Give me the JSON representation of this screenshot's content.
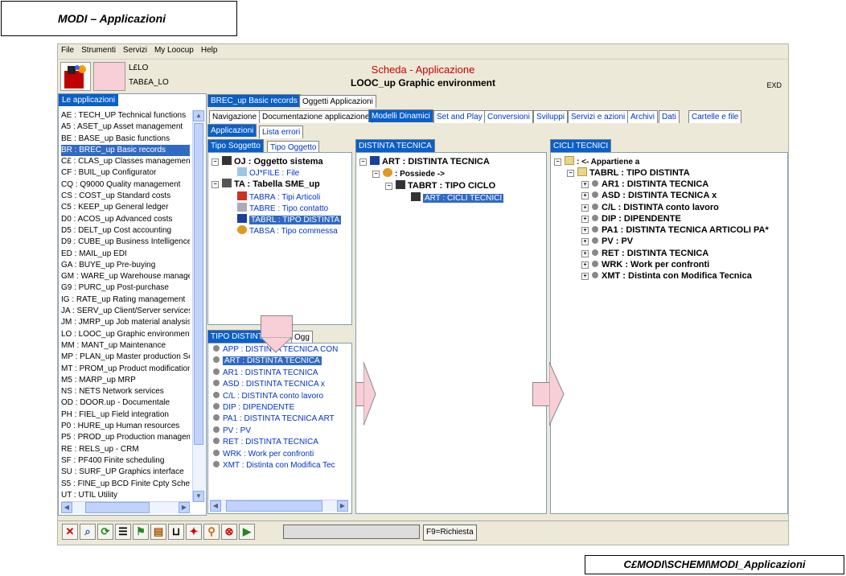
{
  "doc": {
    "title": "MODI – Applicazioni",
    "footer": "C£MODI\\SCHEMI\\MODI_Applicazioni"
  },
  "menu": [
    "File",
    "Strumenti",
    "Servizi",
    "My Loocup",
    "Help"
  ],
  "header": {
    "obj1": "L£LO",
    "obj2": "TAB£A_LO",
    "title": "Scheda - Applicazione",
    "subtitle": "LOOC_up Graphic environment",
    "exd": "EXD"
  },
  "left": {
    "title": "Le applicazioni",
    "items": [
      "AE : TECH_UP Technical functions",
      "A5 : ASET_up Asset management",
      "BE : BASE_up Basic functions",
      "BR : BREC_up Basic records",
      "C£ : CLAS_up Classes management",
      "CF : BUIL_up Configurator",
      "CQ : Q9000  Quality management",
      "CS : COST_up Standard costs",
      "C5 : KEEP_up General ledger",
      "D0 : ACOS_up Advanced costs",
      "D5 : DELT_up Cost accounting",
      "D9 : CUBE_up Business Intelligence",
      "ED : MAIL_up EDI",
      "GA : BUYE_up Pre-buying",
      "GM : WARE_up Warehouse manage",
      "G9 : PURC_up Post-purchase",
      "IG : RATE_up Rating management",
      "JA : SERV_up Client/Server services",
      "JM : JMRP_up Job material analysis",
      "LO : LOOC_up Graphic environment",
      "MM : MANT_up Maintenance",
      "MP : PLAN_up Master production Sc",
      "MT : PROM_up Product modification",
      "M5 : MARP_up MRP",
      "NS : NETS   Network services",
      "OD : DOOR.up - Documentale",
      "PH : FIEL_up Field integration",
      "P0 : HURE_up Human resources",
      "P5 : PROD_up Production managem",
      "RE : RELS_up - CRM",
      "SF : PF400  Finite scheduling",
      "SU : SURF_UP Graphics interface",
      "S5 : FINE_up BCD Finite Cpty Sched",
      "UT : UTIL   Utility"
    ],
    "selected": 3
  },
  "tabs_top": [
    "BREC_up Basic records",
    "Oggetti Applicazioni"
  ],
  "tabs_second": [
    "Navigazione",
    "Documentazione applicazione",
    "Modelli Dinamici",
    "Set and Play",
    "Conversioni",
    "Sviluppi",
    "Servizi e azioni",
    "Archivi",
    "Dati",
    "Cartelle e file"
  ],
  "tabs_third": [
    "Applicazioni",
    "Lista errori"
  ],
  "tipo": {
    "tabs": [
      "Tipo Soggetto",
      "Tipo Oggetto"
    ],
    "nodes": [
      {
        "text": "OJ  : Oggetto sistema",
        "style": "b"
      },
      {
        "text": "OJ*FILE  : File",
        "style": "blue"
      },
      {
        "text": "TA  : Tabella SME_up",
        "style": "b"
      },
      {
        "text": "TABRA  : Tipi Articoli",
        "style": "blue"
      },
      {
        "text": "TABRE  : Tipo contatto",
        "style": "blue"
      },
      {
        "text": "TABRL  : TIPO DISTINTA",
        "style": "sel"
      },
      {
        "text": "TABSA  : Tipo commessa",
        "style": "blue"
      }
    ]
  },
  "tipodist": {
    "title_a": "TIPO DISTINTA",
    "title_b": "Ogg",
    "items": [
      "APP  : DISTINTA TECNICA CON",
      "ART  : DISTINTA TECNICA",
      "AR1  : DISTINTA TECNICA",
      "ASD  : DISTINTA TECNICA x",
      "C/L  : DISTINTA conto lavoro",
      "DIP  : DIPENDENTE",
      "PA1  : DISTINTA TECNICA ART",
      "PV  : PV",
      "RET  : DISTINTA TECNICA",
      "WRK  : Work per confronti",
      "XMT  : Distinta con Modifica Tec"
    ],
    "selected": 1
  },
  "distinta": {
    "title": "DISTINTA TECNICA",
    "nodes": [
      {
        "text": "ART  : DISTINTA TECNICA"
      },
      {
        "text": ": Possiede ->"
      },
      {
        "text": "TABRT  : TIPO CICLO"
      },
      {
        "text": "ART : CICLI TECNICI"
      }
    ]
  },
  "cicli": {
    "title": "CICLI TECNICI",
    "root": ": <- Appartiene a",
    "sub": "TABRL  : TIPO DISTINTA",
    "items": [
      "AR1  : DISTINTA TECNICA",
      "ASD  : DISTINTA TECNICA x",
      "C/L  : DISTINTA conto lavoro",
      "DIP  : DIPENDENTE",
      "PA1  : DISTINTA TECNICA ARTICOLI PA*",
      "PV  : PV",
      "RET  : DISTINTA TECNICA",
      "WRK  : Work per confronti",
      "XMT  : Distinta con Modifica Tecnica"
    ]
  },
  "toolbar": {
    "f9": "F9=Richiesta"
  },
  "colors": {
    "accent": "#0a5fc8",
    "selection": "#316ac5",
    "title_red": "#cc0000",
    "arrow_pink": "#f8cfd6"
  }
}
